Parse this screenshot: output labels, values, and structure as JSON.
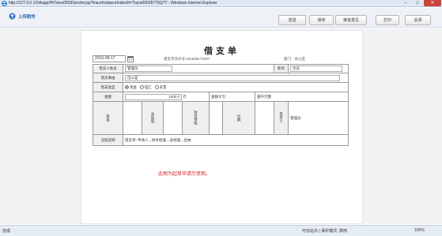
{
  "browser": {
    "title": "http://127.0.0.1/OAapp/HtTrace0503Servlet.jsp?traceInstanceIndexId=Trace00026776Q7Y - Windows Internet Explorer",
    "status_left": "完成",
    "status_zone": "可信站点 | 保护模式: 禁用",
    "zoom": "100%"
  },
  "toolbar": {
    "attach_label": "上传附件",
    "send": "发送",
    "save": "保存",
    "view_approval": "审批意见",
    "print": "打印",
    "close": "关闭"
  },
  "document": {
    "title": "借支单",
    "date": "2016-08-17",
    "doc_no": "借支单流水号:201608170087",
    "dept": "部门：办公室",
    "applicant_label": "借支人姓名",
    "applicant_value": "管理员",
    "position_label": "职务",
    "position_value": "文员",
    "reason_label": "借支事由",
    "reason_value": "出公差",
    "type_label": "借支类型",
    "type_options": [
      "现金",
      "电汇",
      "支票"
    ],
    "amount_label": "金额",
    "amount_value": "1000.0",
    "amount_unit": "元",
    "amount_upper_label": "金额大写：",
    "amount_upper_value": "壹仟元整",
    "approvals": {
      "audit": "审批",
      "general_manager": "总经理",
      "finance_audit": "财务审核",
      "cashier": "出纳",
      "borrower": "借支人",
      "borrower_value": "管理员"
    },
    "flow_label": "流程说明",
    "flow_value": "借支单: 申请人→财务经理→总经理→出纳"
  },
  "note": "此图为起草申请示意图。"
}
